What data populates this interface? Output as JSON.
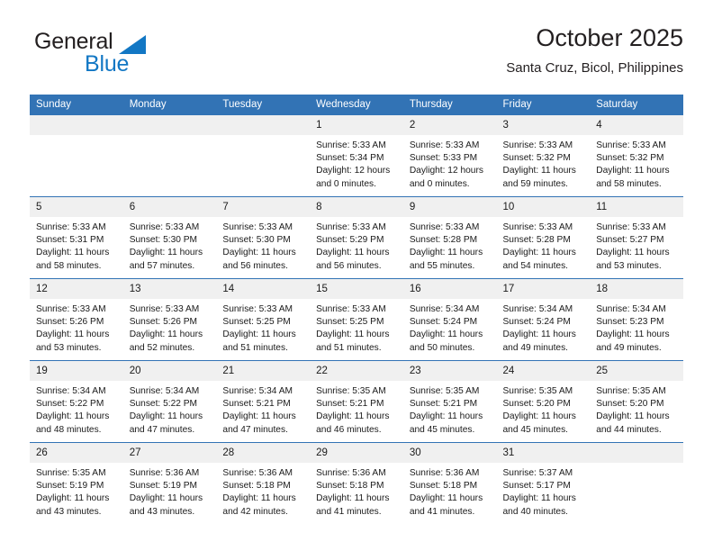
{
  "brand": {
    "word_one": "General",
    "word_two": "Blue",
    "triangle_color": "#1277c4"
  },
  "header": {
    "title": "October 2025",
    "subtitle": "Santa Cruz, Bicol, Philippines"
  },
  "theme": {
    "header_blue": "#3273b5",
    "daynum_bg": "#f0f0f0",
    "text": "#1a1a1a"
  },
  "weekday_headers": [
    "Sunday",
    "Monday",
    "Tuesday",
    "Wednesday",
    "Thursday",
    "Friday",
    "Saturday"
  ],
  "weeks": [
    [
      {
        "day": "",
        "empty": true,
        "sunrise": "",
        "sunset": "",
        "daylight_line1": "",
        "daylight_line2": ""
      },
      {
        "day": "",
        "empty": true,
        "sunrise": "",
        "sunset": "",
        "daylight_line1": "",
        "daylight_line2": ""
      },
      {
        "day": "",
        "empty": true,
        "sunrise": "",
        "sunset": "",
        "daylight_line1": "",
        "daylight_line2": ""
      },
      {
        "day": "1",
        "sunrise": "Sunrise: 5:33 AM",
        "sunset": "Sunset: 5:34 PM",
        "daylight_line1": "Daylight: 12 hours",
        "daylight_line2": "and 0 minutes."
      },
      {
        "day": "2",
        "sunrise": "Sunrise: 5:33 AM",
        "sunset": "Sunset: 5:33 PM",
        "daylight_line1": "Daylight: 12 hours",
        "daylight_line2": "and 0 minutes."
      },
      {
        "day": "3",
        "sunrise": "Sunrise: 5:33 AM",
        "sunset": "Sunset: 5:32 PM",
        "daylight_line1": "Daylight: 11 hours",
        "daylight_line2": "and 59 minutes."
      },
      {
        "day": "4",
        "sunrise": "Sunrise: 5:33 AM",
        "sunset": "Sunset: 5:32 PM",
        "daylight_line1": "Daylight: 11 hours",
        "daylight_line2": "and 58 minutes."
      }
    ],
    [
      {
        "day": "5",
        "sunrise": "Sunrise: 5:33 AM",
        "sunset": "Sunset: 5:31 PM",
        "daylight_line1": "Daylight: 11 hours",
        "daylight_line2": "and 58 minutes."
      },
      {
        "day": "6",
        "sunrise": "Sunrise: 5:33 AM",
        "sunset": "Sunset: 5:30 PM",
        "daylight_line1": "Daylight: 11 hours",
        "daylight_line2": "and 57 minutes."
      },
      {
        "day": "7",
        "sunrise": "Sunrise: 5:33 AM",
        "sunset": "Sunset: 5:30 PM",
        "daylight_line1": "Daylight: 11 hours",
        "daylight_line2": "and 56 minutes."
      },
      {
        "day": "8",
        "sunrise": "Sunrise: 5:33 AM",
        "sunset": "Sunset: 5:29 PM",
        "daylight_line1": "Daylight: 11 hours",
        "daylight_line2": "and 56 minutes."
      },
      {
        "day": "9",
        "sunrise": "Sunrise: 5:33 AM",
        "sunset": "Sunset: 5:28 PM",
        "daylight_line1": "Daylight: 11 hours",
        "daylight_line2": "and 55 minutes."
      },
      {
        "day": "10",
        "sunrise": "Sunrise: 5:33 AM",
        "sunset": "Sunset: 5:28 PM",
        "daylight_line1": "Daylight: 11 hours",
        "daylight_line2": "and 54 minutes."
      },
      {
        "day": "11",
        "sunrise": "Sunrise: 5:33 AM",
        "sunset": "Sunset: 5:27 PM",
        "daylight_line1": "Daylight: 11 hours",
        "daylight_line2": "and 53 minutes."
      }
    ],
    [
      {
        "day": "12",
        "sunrise": "Sunrise: 5:33 AM",
        "sunset": "Sunset: 5:26 PM",
        "daylight_line1": "Daylight: 11 hours",
        "daylight_line2": "and 53 minutes."
      },
      {
        "day": "13",
        "sunrise": "Sunrise: 5:33 AM",
        "sunset": "Sunset: 5:26 PM",
        "daylight_line1": "Daylight: 11 hours",
        "daylight_line2": "and 52 minutes."
      },
      {
        "day": "14",
        "sunrise": "Sunrise: 5:33 AM",
        "sunset": "Sunset: 5:25 PM",
        "daylight_line1": "Daylight: 11 hours",
        "daylight_line2": "and 51 minutes."
      },
      {
        "day": "15",
        "sunrise": "Sunrise: 5:33 AM",
        "sunset": "Sunset: 5:25 PM",
        "daylight_line1": "Daylight: 11 hours",
        "daylight_line2": "and 51 minutes."
      },
      {
        "day": "16",
        "sunrise": "Sunrise: 5:34 AM",
        "sunset": "Sunset: 5:24 PM",
        "daylight_line1": "Daylight: 11 hours",
        "daylight_line2": "and 50 minutes."
      },
      {
        "day": "17",
        "sunrise": "Sunrise: 5:34 AM",
        "sunset": "Sunset: 5:24 PM",
        "daylight_line1": "Daylight: 11 hours",
        "daylight_line2": "and 49 minutes."
      },
      {
        "day": "18",
        "sunrise": "Sunrise: 5:34 AM",
        "sunset": "Sunset: 5:23 PM",
        "daylight_line1": "Daylight: 11 hours",
        "daylight_line2": "and 49 minutes."
      }
    ],
    [
      {
        "day": "19",
        "sunrise": "Sunrise: 5:34 AM",
        "sunset": "Sunset: 5:22 PM",
        "daylight_line1": "Daylight: 11 hours",
        "daylight_line2": "and 48 minutes."
      },
      {
        "day": "20",
        "sunrise": "Sunrise: 5:34 AM",
        "sunset": "Sunset: 5:22 PM",
        "daylight_line1": "Daylight: 11 hours",
        "daylight_line2": "and 47 minutes."
      },
      {
        "day": "21",
        "sunrise": "Sunrise: 5:34 AM",
        "sunset": "Sunset: 5:21 PM",
        "daylight_line1": "Daylight: 11 hours",
        "daylight_line2": "and 47 minutes."
      },
      {
        "day": "22",
        "sunrise": "Sunrise: 5:35 AM",
        "sunset": "Sunset: 5:21 PM",
        "daylight_line1": "Daylight: 11 hours",
        "daylight_line2": "and 46 minutes."
      },
      {
        "day": "23",
        "sunrise": "Sunrise: 5:35 AM",
        "sunset": "Sunset: 5:21 PM",
        "daylight_line1": "Daylight: 11 hours",
        "daylight_line2": "and 45 minutes."
      },
      {
        "day": "24",
        "sunrise": "Sunrise: 5:35 AM",
        "sunset": "Sunset: 5:20 PM",
        "daylight_line1": "Daylight: 11 hours",
        "daylight_line2": "and 45 minutes."
      },
      {
        "day": "25",
        "sunrise": "Sunrise: 5:35 AM",
        "sunset": "Sunset: 5:20 PM",
        "daylight_line1": "Daylight: 11 hours",
        "daylight_line2": "and 44 minutes."
      }
    ],
    [
      {
        "day": "26",
        "sunrise": "Sunrise: 5:35 AM",
        "sunset": "Sunset: 5:19 PM",
        "daylight_line1": "Daylight: 11 hours",
        "daylight_line2": "and 43 minutes."
      },
      {
        "day": "27",
        "sunrise": "Sunrise: 5:36 AM",
        "sunset": "Sunset: 5:19 PM",
        "daylight_line1": "Daylight: 11 hours",
        "daylight_line2": "and 43 minutes."
      },
      {
        "day": "28",
        "sunrise": "Sunrise: 5:36 AM",
        "sunset": "Sunset: 5:18 PM",
        "daylight_line1": "Daylight: 11 hours",
        "daylight_line2": "and 42 minutes."
      },
      {
        "day": "29",
        "sunrise": "Sunrise: 5:36 AM",
        "sunset": "Sunset: 5:18 PM",
        "daylight_line1": "Daylight: 11 hours",
        "daylight_line2": "and 41 minutes."
      },
      {
        "day": "30",
        "sunrise": "Sunrise: 5:36 AM",
        "sunset": "Sunset: 5:18 PM",
        "daylight_line1": "Daylight: 11 hours",
        "daylight_line2": "and 41 minutes."
      },
      {
        "day": "31",
        "sunrise": "Sunrise: 5:37 AM",
        "sunset": "Sunset: 5:17 PM",
        "daylight_line1": "Daylight: 11 hours",
        "daylight_line2": "and 40 minutes."
      },
      {
        "day": "",
        "empty": true,
        "sunrise": "",
        "sunset": "",
        "daylight_line1": "",
        "daylight_line2": ""
      }
    ]
  ]
}
